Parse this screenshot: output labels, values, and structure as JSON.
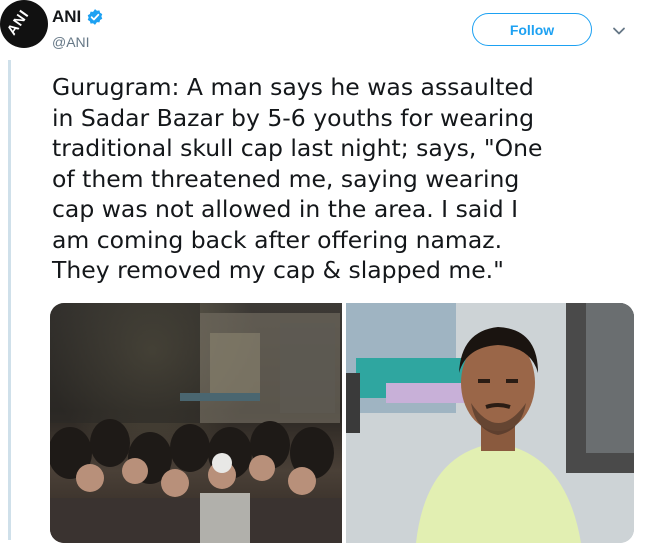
{
  "account": {
    "name": "ANI",
    "handle": "@ANI",
    "avatar_text": "ANI",
    "verified_icon": "verified-badge-icon"
  },
  "actions": {
    "follow_label": "Follow",
    "menu_icon": "chevron-down-icon"
  },
  "tweet": {
    "text": "Gurugram: A man says he was assaulted\nin Sadar Bazar by 5-6 youths for wearing\ntraditional skull cap last night; says, \"One\nof them threatened me, saying wearing\ncap was not allowed in the area. I said I\nam coming back after offering namaz.\nThey removed my cap & slapped me.\""
  },
  "media": {
    "count": 2
  },
  "colors": {
    "accent": "#1da1f2",
    "text": "#14171a",
    "secondary_text": "#657786",
    "thread_line": "#cfe0ea"
  }
}
